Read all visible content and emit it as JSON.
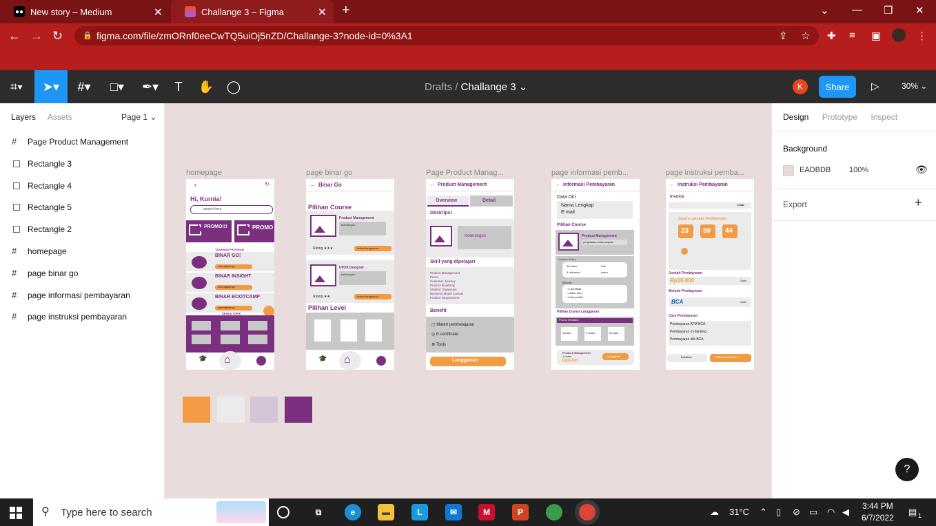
{
  "browser": {
    "tabs": [
      {
        "title": "New story – Medium",
        "active": false
      },
      {
        "title": "Challange 3 – Figma",
        "active": true
      }
    ],
    "url": "figma.com/file/zmORnf0eeCwTQ5uiOj5nZD/Challange-3?node-id=0%3A1"
  },
  "figma": {
    "breadcrumb_root": "Drafts",
    "breadcrumb_sep": "/",
    "file_name": "Challange 3",
    "user_initial": "K",
    "share_label": "Share",
    "zoom": "30%"
  },
  "left_panel": {
    "tabs": [
      "Layers",
      "Assets"
    ],
    "page_selector": "Page 1",
    "layers": [
      {
        "name": "Page Product Management",
        "type": "frame"
      },
      {
        "name": "Rectangle 3",
        "type": "rect"
      },
      {
        "name": "Rectangle 4",
        "type": "rect"
      },
      {
        "name": "Rectangle 5",
        "type": "rect"
      },
      {
        "name": "Rectangle 2",
        "type": "rect"
      },
      {
        "name": "homepage",
        "type": "frame"
      },
      {
        "name": "page binar go",
        "type": "frame"
      },
      {
        "name": "page informasi pembayaran",
        "type": "frame"
      },
      {
        "name": "page instruksi pembayaran",
        "type": "frame"
      }
    ]
  },
  "right_panel": {
    "tabs": [
      "Design",
      "Prototype",
      "Inspect"
    ],
    "background_label": "Background",
    "background_hex": "EADBDB",
    "background_opacity": "100%",
    "export_label": "Export"
  },
  "canvas": {
    "frames": [
      {
        "label": "homepage"
      },
      {
        "label": "page binar go"
      },
      {
        "label": "Page Product Manag..."
      },
      {
        "label": "page informasi pemb..."
      },
      {
        "label": "page instruksi pemba..."
      }
    ],
    "homepage": {
      "greeting": "Hi, Kurnia!",
      "search_placeholder": "search here",
      "promo1": "PROMO!!!",
      "promo2": "PROMO",
      "section": "TAWARAN PROGRAM",
      "items": [
        "BINAR GO!",
        "BINAR INSIGHT",
        "BINAR BOOTCAMP"
      ],
      "cta": "selengkapnya",
      "more": "SEMUA TOPIK"
    },
    "binargo": {
      "title": "Binar Go",
      "section": "Pilihan Course",
      "course1": "Product Management",
      "course2": "UI/UX Designer",
      "desc": "keterangan",
      "rating": "Rating",
      "button": "button langganan",
      "level": "Pilihan Level"
    },
    "productmgmt": {
      "title": "Product Management",
      "tab1": "Overview",
      "tab2": "Detail",
      "desc_title": "Deskripsi",
      "desc_body": "Keterangan",
      "skills_title": "Skill yang dipelajari",
      "skills": [
        "Product Management",
        "Peran",
        "Customer Journey",
        "Product Roadmap",
        "Struktur Organisasi",
        "Business Model Canvas",
        "Product Requirement"
      ],
      "benefit_title": "Benefit",
      "benefits": [
        "Materi pembelajaran",
        "E-certificate",
        "Tools"
      ],
      "cta": "Langganan"
    },
    "infobayar": {
      "title": "Informasi Pembayaran",
      "data_diri": "Data Diri",
      "nama": "Nama Lengkap",
      "email": "E-mail",
      "pilihan_course": "Pilihan Course",
      "course": "Product Management",
      "course_desc": "penjelasan kelas singkat",
      "konten": "Konten Kelas",
      "video": "55 video",
      "dokumen": "5 dokumen",
      "kuis": "kuiz",
      "exam": "exam",
      "benefit": "Benefit",
      "benefits": [
        "e-sertifikat",
        "materi baru",
        "tools praktis"
      ],
      "durasi": "Pilihan Durasi Langganan",
      "promo": "Promo terbatas!",
      "durations": [
        "1bulan",
        "3 bulan",
        "6 bulan"
      ],
      "summary_course": "Product Management",
      "summary_duration": "1 bulan",
      "price": "Rp16.000",
      "cta": "Langganan"
    },
    "instruksi": {
      "title": "Instruksi Pembayaran",
      "invoice": "Invoice",
      "lihat": "Lihat",
      "segera": "Segera Lakukan Pembayaran",
      "hh": "23",
      "mm": "59",
      "ss": "44",
      "jumlah_label": "Jumlah Pembayaran",
      "jumlah": "Rp16.000",
      "salin": "Salin",
      "metode": "Metode Pembayaran",
      "bank": "BCA",
      "cara": "Cara Pembayaran",
      "steps": [
        "Pembayaran ATM BCA",
        "Pembayaran m-banking",
        "Pembayaran klik BCA"
      ],
      "batal": "Batalkan",
      "status": "Status pembelian"
    },
    "swatches": [
      "#f39b43",
      "#ebebeb",
      "#d6c5d8",
      "#7b2f7f"
    ]
  },
  "taskbar": {
    "search_placeholder": "Type here to search",
    "weather": "31°C",
    "time": "3:44 PM",
    "date": "6/7/2022",
    "notif_count": "1"
  }
}
